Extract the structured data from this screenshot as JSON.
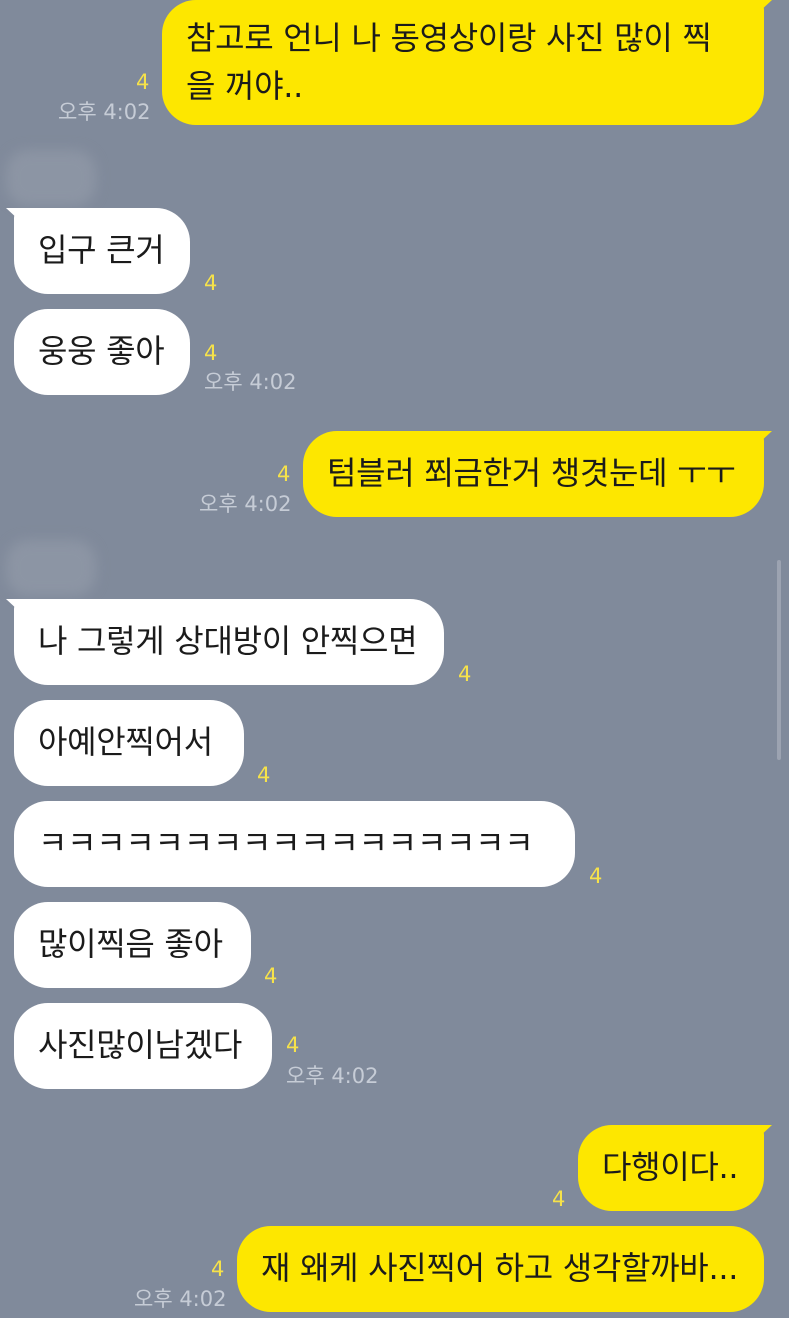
{
  "theme": {
    "background": "#808a9b",
    "outgoing_bubble": "#fde700",
    "incoming_bubble": "#ffffff",
    "unread_color": "#f6e24a",
    "time_color": "#c6ccd6"
  },
  "messages": [
    {
      "side": "out",
      "text": "참고로 언니 나 동영상이랑 사진 많이 찍을 꺼야..",
      "unread": "4",
      "time": "오후 4:02"
    },
    {
      "side": "in",
      "text": "입구 큰거",
      "unread": "4",
      "time": ""
    },
    {
      "side": "in",
      "text": "웅웅 좋아",
      "unread": "4",
      "time": "오후 4:02"
    },
    {
      "side": "out",
      "text": "텀블러 쬐금한거 챙겻눈데 ㅜㅜ",
      "unread": "4",
      "time": "오후 4:02"
    },
    {
      "side": "in",
      "text": "나 그렇게 상대방이 안찍으면",
      "unread": "4",
      "time": ""
    },
    {
      "side": "in",
      "text": "아예안찍어서",
      "unread": "4",
      "time": ""
    },
    {
      "side": "in",
      "text": "ㅋㅋㅋㅋㅋㅋㅋㅋㅋㅋㅋㅋㅋㅋㅋㅋㅋ",
      "unread": "4",
      "time": ""
    },
    {
      "side": "in",
      "text": "많이찍음 좋아",
      "unread": "4",
      "time": ""
    },
    {
      "side": "in",
      "text": "사진많이남겠다",
      "unread": "4",
      "time": "오후 4:02"
    },
    {
      "side": "out",
      "text": "다행이다..",
      "unread": "4",
      "time": ""
    },
    {
      "side": "out",
      "text": "재 왜케 사진찍어 하고 생각할까바...",
      "unread": "4",
      "time": "오후 4:02"
    }
  ]
}
